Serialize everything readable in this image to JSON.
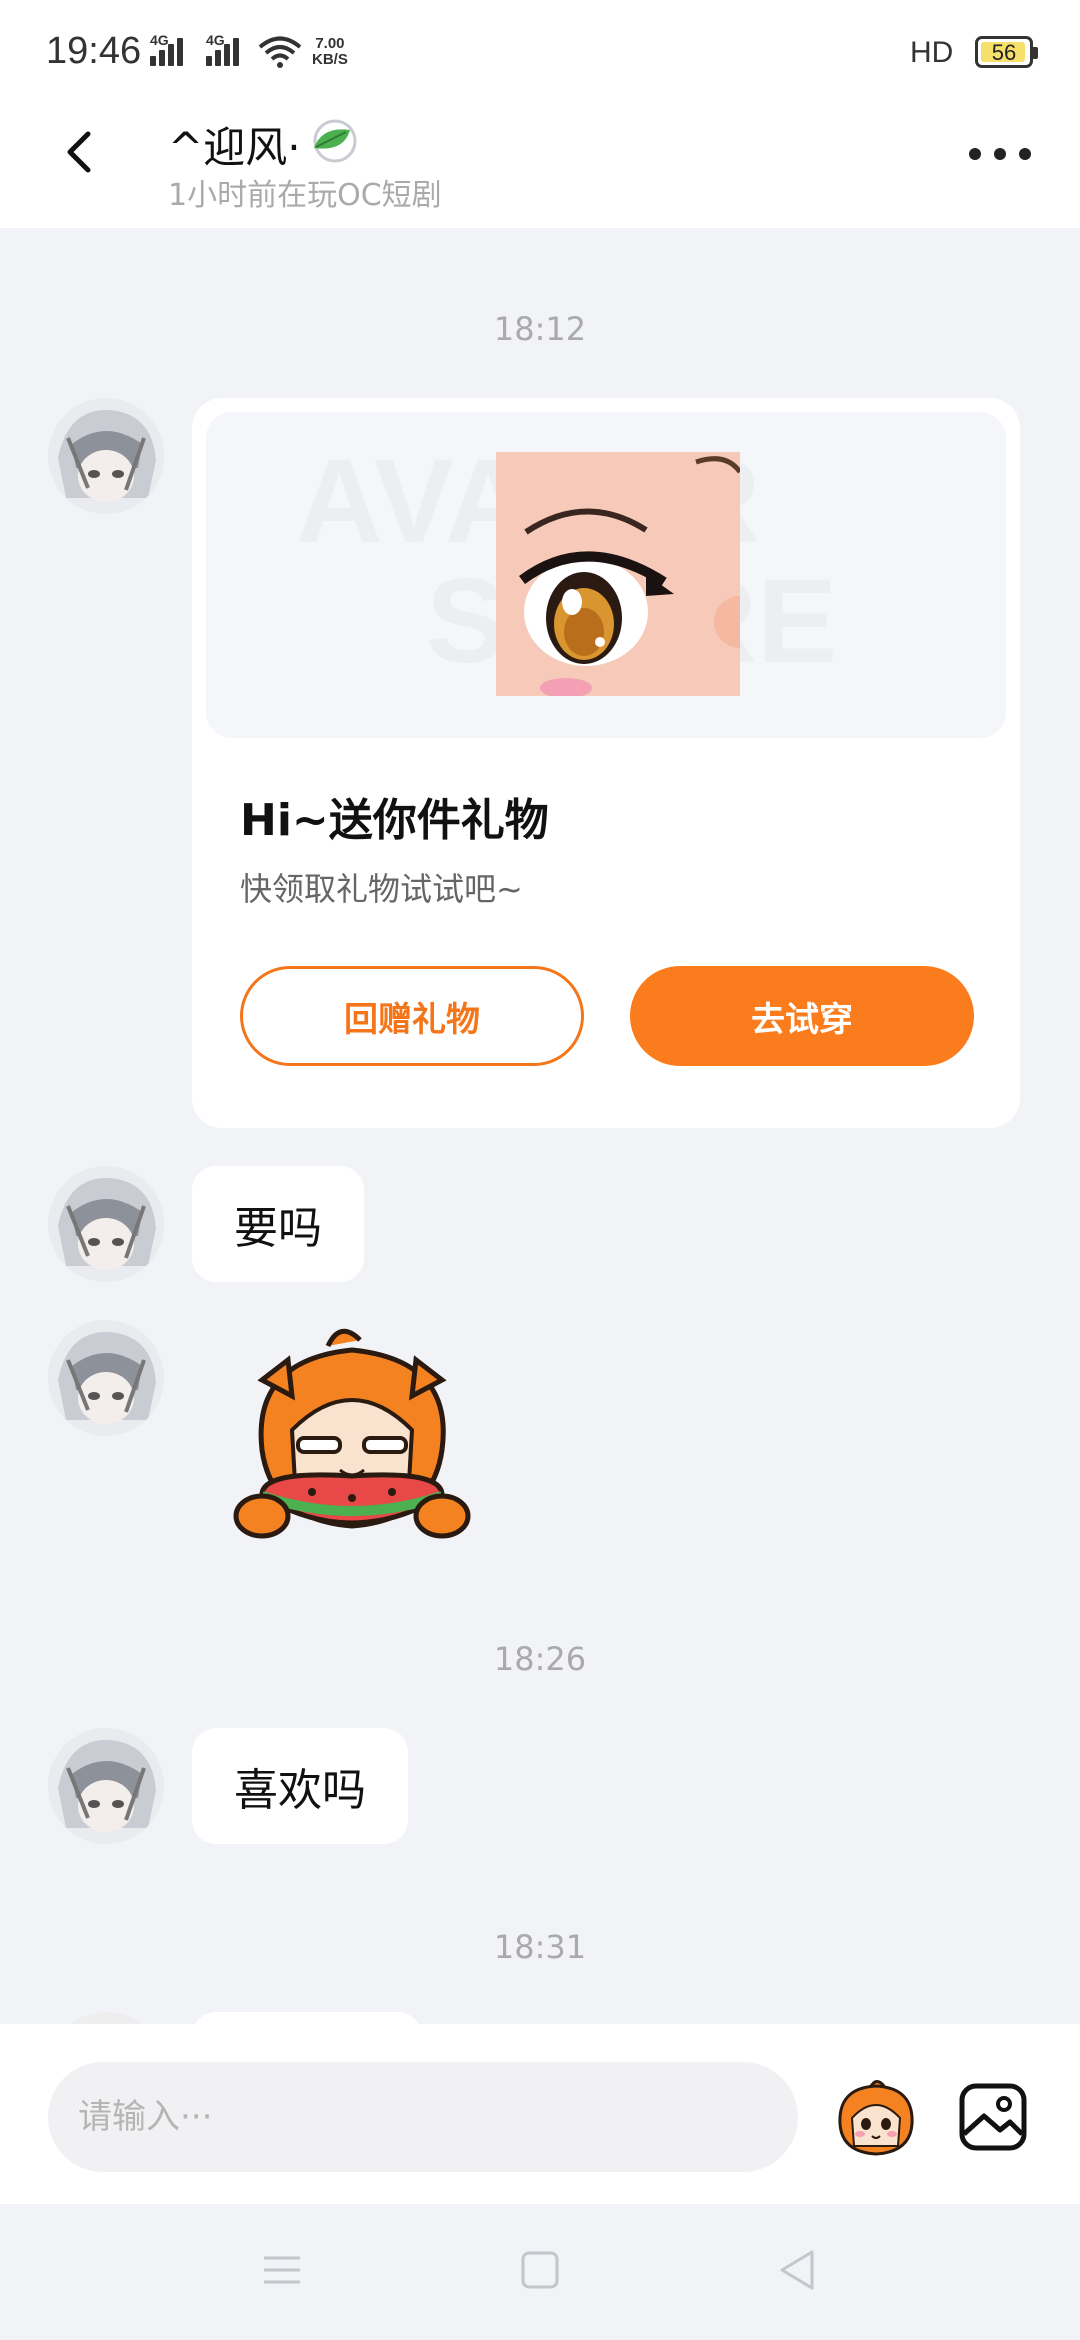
{
  "status_bar": {
    "time": "19:46",
    "signal_1_label": "4G",
    "signal_2_label": "4G",
    "net_speed_value": "7.00",
    "net_speed_unit": "KB/S",
    "hd_label": "HD",
    "battery_level": "56"
  },
  "header": {
    "contact_name": "^迎风·",
    "status_text": "1小时前在玩OC短剧"
  },
  "messages": {
    "time_1": "18:12",
    "gift_card": {
      "title": "Hi~送你件礼物",
      "description": "快领取礼物试试吧~",
      "return_gift_label": "回赠礼物",
      "try_on_label": "去试穿",
      "watermark_line_1": "AVATAR",
      "watermark_line_2": "STORE"
    },
    "text_1": "要吗",
    "time_2": "18:26",
    "text_2": "喜欢吗",
    "time_3": "18:31"
  },
  "input": {
    "placeholder": "请输入···"
  },
  "colors": {
    "accent": "#fb7c1c",
    "background": "#f2f3f7",
    "card": "#ffffff"
  },
  "icons": [
    "back-arrow-icon",
    "more-icon",
    "leaf-icon",
    "emoji-icon",
    "image-icon",
    "nav-menu-icon",
    "nav-home-icon",
    "nav-back-icon"
  ]
}
